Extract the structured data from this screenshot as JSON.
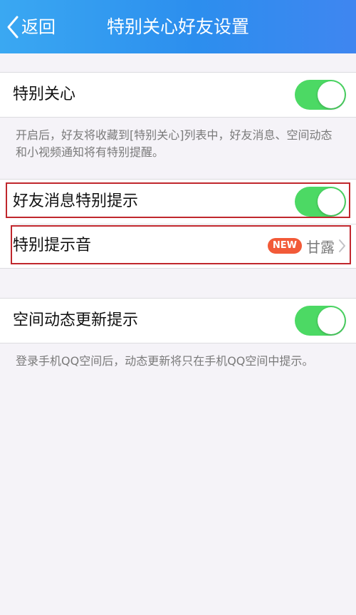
{
  "header": {
    "back_label": "返回",
    "title": "特别关心好友设置"
  },
  "special_care": {
    "label": "特别关心",
    "enabled": true,
    "hint": "开启后，好友将收藏到[特别关心]列表中，好友消息、空间动态和小视频通知将有特别提醒。"
  },
  "message_alert": {
    "label": "好友消息特别提示",
    "enabled": true
  },
  "alert_sound": {
    "label": "特别提示音",
    "badge": "NEW",
    "value": "甘露"
  },
  "zone_updates": {
    "label": "空间动态更新提示",
    "enabled": true,
    "hint": "登录手机QQ空间后，动态更新将只在手机QQ空间中提示。"
  },
  "colors": {
    "header_start": "#3aa8f2",
    "header_end": "#3f86f0",
    "toggle_on": "#4cd964",
    "badge": "#f25a38",
    "highlight": "#c0272d"
  },
  "icons": {
    "back": "chevron-left-icon",
    "disclosure": "chevron-right-icon"
  }
}
